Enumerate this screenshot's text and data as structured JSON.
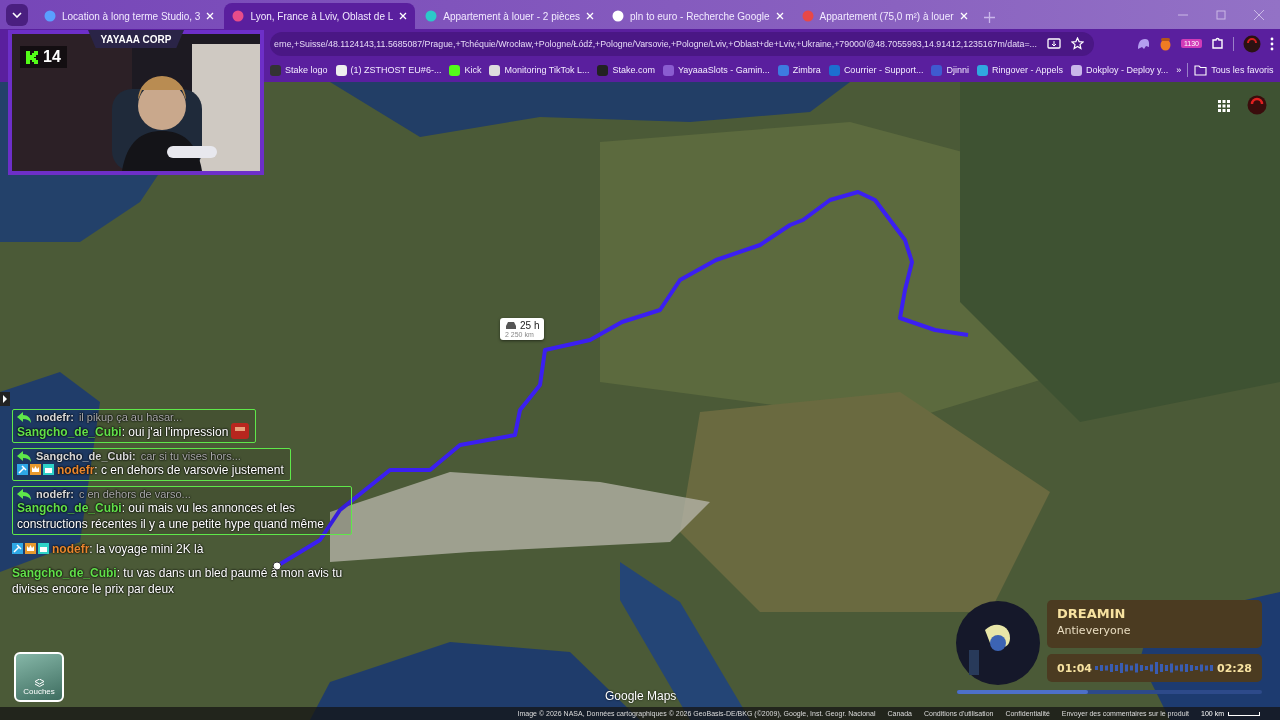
{
  "browser": {
    "tabs": [
      {
        "title": "Location à long terme Studio, 3",
        "selected": false
      },
      {
        "title": "Lyon, France à Lviv, Oblast de L",
        "selected": true
      },
      {
        "title": "Appartement à louer - 2 pièces",
        "selected": false
      },
      {
        "title": "pln to euro - Recherche Google",
        "selected": false
      },
      {
        "title": "Appartement (75,0 m²) à louer",
        "selected": false
      }
    ],
    "address": "erne,+Suisse/48.1124143,11.5685087/Prague,+Tchéquie/Wrocław,+Pologne/Łódź,+Pologne/Varsovie,+Pologne/Lviv,+Oblast+de+Lviv,+Ukraine,+79000/@48.7055993,14.91412,1235167m/data=...",
    "extension_badge": "1130",
    "bookmarks": [
      {
        "label": "Stake logo"
      },
      {
        "label": "(1) ZSTHOST EU#6-..."
      },
      {
        "label": "Kick"
      },
      {
        "label": "Monitoring TikTok L..."
      },
      {
        "label": "Stake.com"
      },
      {
        "label": "YayaaaSlots - Gamin..."
      },
      {
        "label": "Zimbra"
      },
      {
        "label": "Courrier - Support..."
      },
      {
        "label": "Djinni"
      },
      {
        "label": "Ringover - Appels"
      },
      {
        "label": "Dokploy - Deploy y..."
      }
    ],
    "more": "»",
    "all_bookmarks": "Tous les favoris"
  },
  "stream_cam": {
    "title": "YAYAAA CORP",
    "viewer_count": "14"
  },
  "map": {
    "route_badge": {
      "duration": "25 h",
      "distance": "2 250 km"
    },
    "layers_button": "Couches",
    "logo": "Google Maps",
    "footer": [
      "Image © 2026 NASA, Données cartographiques © 2026 GeoBasis-DE/BKG (©2009), Google, Inst. Geogr. Nacional",
      "Canada",
      "Conditions d'utilisation",
      "Confidentialité",
      "Envoyer des commentaires sur le produit"
    ],
    "scale": "100 km"
  },
  "chat": [
    {
      "kind": "reply",
      "reply_user": "nodefr:",
      "reply_text": "il pikup ça au hasar...",
      "badges": false,
      "user": "Sangcho_de_Cubi",
      "color": "#62e04a",
      "text": ": oui j'ai l'impression",
      "emote": true
    },
    {
      "kind": "reply",
      "reply_user": "Sangcho_de_Cubi:",
      "reply_text": "car si tu vises hors...",
      "badges": true,
      "user": "nodefr",
      "color": "#e8862e",
      "text": ": c en dehors de varsovie justement",
      "emote": false
    },
    {
      "kind": "reply",
      "reply_user": "nodefr:",
      "reply_text": "c en dehors de varso...",
      "badges": false,
      "user": "Sangcho_de_Cubi",
      "color": "#62e04a",
      "text": ": oui mais vu les annonces et les constructions récentes il y a une petite hype quand même",
      "emote": false
    },
    {
      "kind": "plain",
      "badges": true,
      "user": "nodefr",
      "color": "#e8862e",
      "text": ": la voyage mini 2K là",
      "emote": false
    },
    {
      "kind": "plain",
      "badges": false,
      "user": "Sangcho_de_Cubi",
      "color": "#62e04a",
      "text": ": tu vas dans un bled paumé à mon avis tu divises encore le prix par deux",
      "emote": false
    }
  ],
  "player": {
    "title": "DREAMIN",
    "artist": "Antieveryone",
    "elapsed": "01:04",
    "duration": "02:28",
    "level": 0.43
  }
}
